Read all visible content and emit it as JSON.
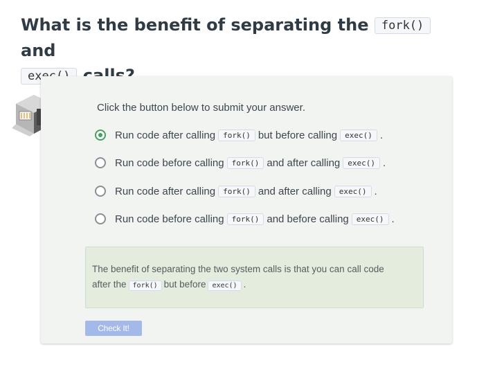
{
  "question": {
    "title_part1": "What is the benefit of separating the",
    "title_code1": "fork()",
    "title_part2": "and",
    "title_code2": "exec()",
    "title_part3": "calls?"
  },
  "quiz": {
    "prompt": "Click the button below to submit your answer.",
    "options": [
      {
        "t1": "Run code after calling",
        "c1": "fork()",
        "t2": "but before calling",
        "c2": "exec()",
        "t3": ".",
        "selected": true
      },
      {
        "t1": "Run code before calling",
        "c1": "fork()",
        "t2": "and after calling",
        "c2": "exec()",
        "t3": ".",
        "selected": false
      },
      {
        "t1": "Run code after calling",
        "c1": "fork()",
        "t2": "and after calling",
        "c2": "exec()",
        "t3": ".",
        "selected": false
      },
      {
        "t1": "Run code before calling",
        "c1": "fork()",
        "t2": "and before calling",
        "c2": "exec()",
        "t3": ".",
        "selected": false
      }
    ],
    "feedback": {
      "line1": "The benefit of separating the two system calls is that you can call code",
      "line2_a": "after the",
      "line2_code1": "fork()",
      "line2_b": "but before",
      "line2_code2": "exec()",
      "line2_c": "."
    },
    "check_button": "Check It!"
  },
  "colors": {
    "selected_radio": "#3fa35f",
    "check_button_bg": "#a3b9e9",
    "feedback_bg": "#e3ecdd",
    "card_bg": "#f2f4f1"
  },
  "icons": {
    "logo": "server-rack-cube-icon"
  }
}
